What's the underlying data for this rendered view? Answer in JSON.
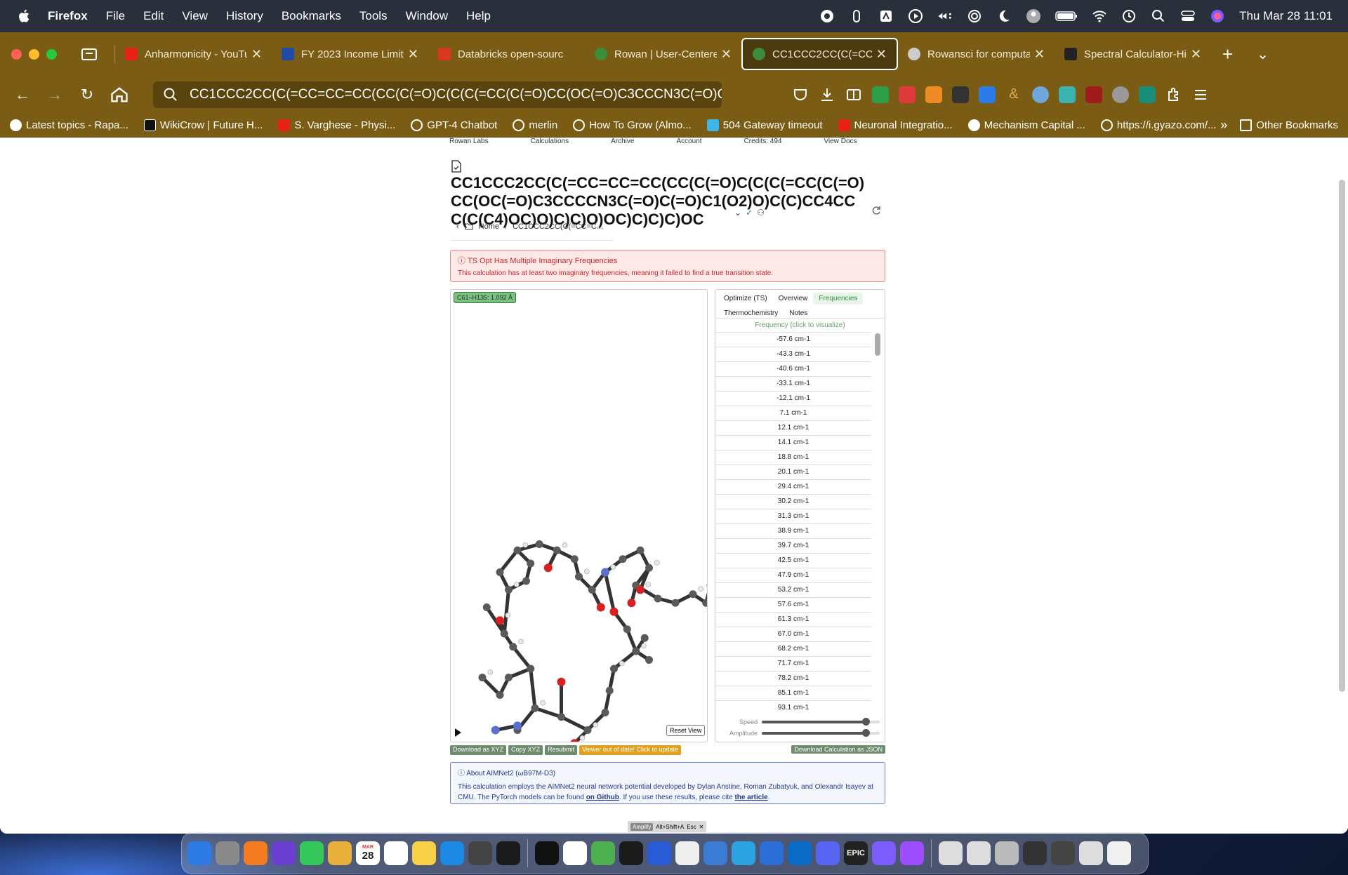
{
  "menubar": {
    "app": "Firefox",
    "items": [
      "File",
      "Edit",
      "View",
      "History",
      "Bookmarks",
      "Tools",
      "Window",
      "Help"
    ],
    "clock": "Thu Mar 28  11:01"
  },
  "tabs": [
    {
      "label": "Anharmonicity - YouTub",
      "color": "#e62117"
    },
    {
      "label": "FY 2023 Income Limits",
      "color": "#1f4aa8"
    },
    {
      "label": "Databricks open-sourc",
      "color": "#d9381e"
    },
    {
      "label": "Rowan | User-Centere",
      "color": "#3b8c3b"
    },
    {
      "label": "CC1CCC2CC(C(=CC=C",
      "color": "#3b8c3b",
      "active": true
    },
    {
      "label": "Rowansci for computat",
      "color": "#cccccc"
    },
    {
      "label": "Spectral Calculator-Hi",
      "color": "#222222"
    }
  ],
  "urlbar": {
    "url": "CC1CCC2CC(C(=CC=CC=CC(CC(C(=O)C(C(C(=CC(C(=O)CC(OC(=O)C3CCCN3C(=O)C(="
  },
  "bookmarks": [
    {
      "label": "Latest topics - Rapa...",
      "color": "#ffffff"
    },
    {
      "label": "WikiCrow | Future H...",
      "color": "#111111"
    },
    {
      "label": "S. Varghese - Physi...",
      "color": "#e62117"
    },
    {
      "label": "GPT-4 Chatbot",
      "color": "#ffffff"
    },
    {
      "label": "merlin",
      "color": "#ffffff"
    },
    {
      "label": "How To Grow (Almo...",
      "color": "#ffffff"
    },
    {
      "label": "504 Gateway timeout",
      "color": "#3fb6e8"
    },
    {
      "label": "Neuronal Integratio...",
      "color": "#e62117"
    },
    {
      "label": "Mechanism Capital ...",
      "color": "#ffffff"
    },
    {
      "label": "https://i.gyazo.com/...",
      "color": "#ffffff"
    }
  ],
  "bookmarks_other": "Other Bookmarks",
  "page": {
    "topnav": [
      "Rowan Labs",
      "Calculations",
      "Archive",
      "Account",
      "Credits: 494",
      "View Docs"
    ],
    "title": "CC1CCC2CC(C(=CC=CC=CC(CC(C(=O)C(C(C(=CC(C(=O)CC(OC(=O)C3CCCCN3C(=O)C(=O)C1(O2)O)C(C)CC4CCC(C(C4)OC)O)C)C)O)OC)C)C)C)OC",
    "breadcrumb_home": "Home",
    "breadcrumb_current": "CC1CCC2CC(C(=CC=C...",
    "alert_title": "TS Opt Has Multiple Imaginary Frequencies",
    "alert_desc": "This calculation has at least two imaginary frequencies, meaning it failed to find a true transition state.",
    "distance_badge": "C61–H135: 1.092 Å",
    "reset_view": "Reset View",
    "panel_tabs": [
      "Optimize (TS)",
      "Overview",
      "Frequencies",
      "Thermochemistry",
      "Notes"
    ],
    "active_panel_tab": "Frequencies",
    "freq_header": "Frequency (click to visualize)",
    "frequencies": [
      "-57.6 cm-1",
      "-43.3 cm-1",
      "-40.6 cm-1",
      "-33.1 cm-1",
      "-12.1 cm-1",
      "7.1 cm-1",
      "12.1 cm-1",
      "14.1 cm-1",
      "18.8 cm-1",
      "20.1 cm-1",
      "29.4 cm-1",
      "30.2 cm-1",
      "31.3 cm-1",
      "38.9 cm-1",
      "39.7 cm-1",
      "42.5 cm-1",
      "47.9 cm-1",
      "53.2 cm-1",
      "57.6 cm-1",
      "61.3 cm-1",
      "67.0 cm-1",
      "68.2 cm-1",
      "71.7 cm-1",
      "78.2 cm-1",
      "85.1 cm-1",
      "93.1 cm-1"
    ],
    "speed_label": "Speed",
    "amplitude_label": "Amplitude",
    "speed_value": 0.88,
    "amplitude_value": 0.88,
    "buttons": {
      "download_xyz": "Download as XYZ",
      "copy_xyz": "Copy XYZ",
      "resubmit": "Resubmit",
      "viewer_outdated": "Viewer out of date! Click to update",
      "download_json": "Download Calculation as JSON"
    },
    "about_title": "About AIMNet2 (ωB97M-D3)",
    "about_desc_1": "This calculation employs the AIMNet2 neural network potential developed by Dylan Anstine, Roman Zubatyuk, and Olexandr Isayev at CMU. The PyTorch models can be found ",
    "about_link_1": "on Github",
    "about_desc_2": ". If you use these results, please cite ",
    "about_link_2": "the article",
    "about_desc_3": "."
  },
  "amplify": {
    "label": "Amplify",
    "shortcut": "Alt+Shift+A",
    "esc": "Esc"
  },
  "dock": {
    "calendar_month": "MAR",
    "calendar_day": "28",
    "epic_label": "EPIC",
    "icon_colors": [
      "#2d7be5",
      "#8a8a8a",
      "#f47b20",
      "#6b3fd1",
      "#34c759",
      "#e8b03a",
      "#ffffff",
      "#ffffff",
      "#f7d046",
      "#1e88e5",
      "#444444",
      "#1a1a1a",
      "#111111",
      "#ffffff",
      "#4caf50",
      "#1a1a1a",
      "#2a5bd7",
      "#eeeeee",
      "#3a7bd5",
      "#2ba3e0",
      "#2b6fd6",
      "#0a6bc7",
      "#5865f2",
      "#222222",
      "#7a5cff",
      "#9b4dff",
      "#dddddd",
      "#dddddd",
      "#bbbbbb",
      "#333333",
      "#444444",
      "#dddddd",
      "#f0f0f0",
      "#444444",
      "#888888"
    ]
  }
}
